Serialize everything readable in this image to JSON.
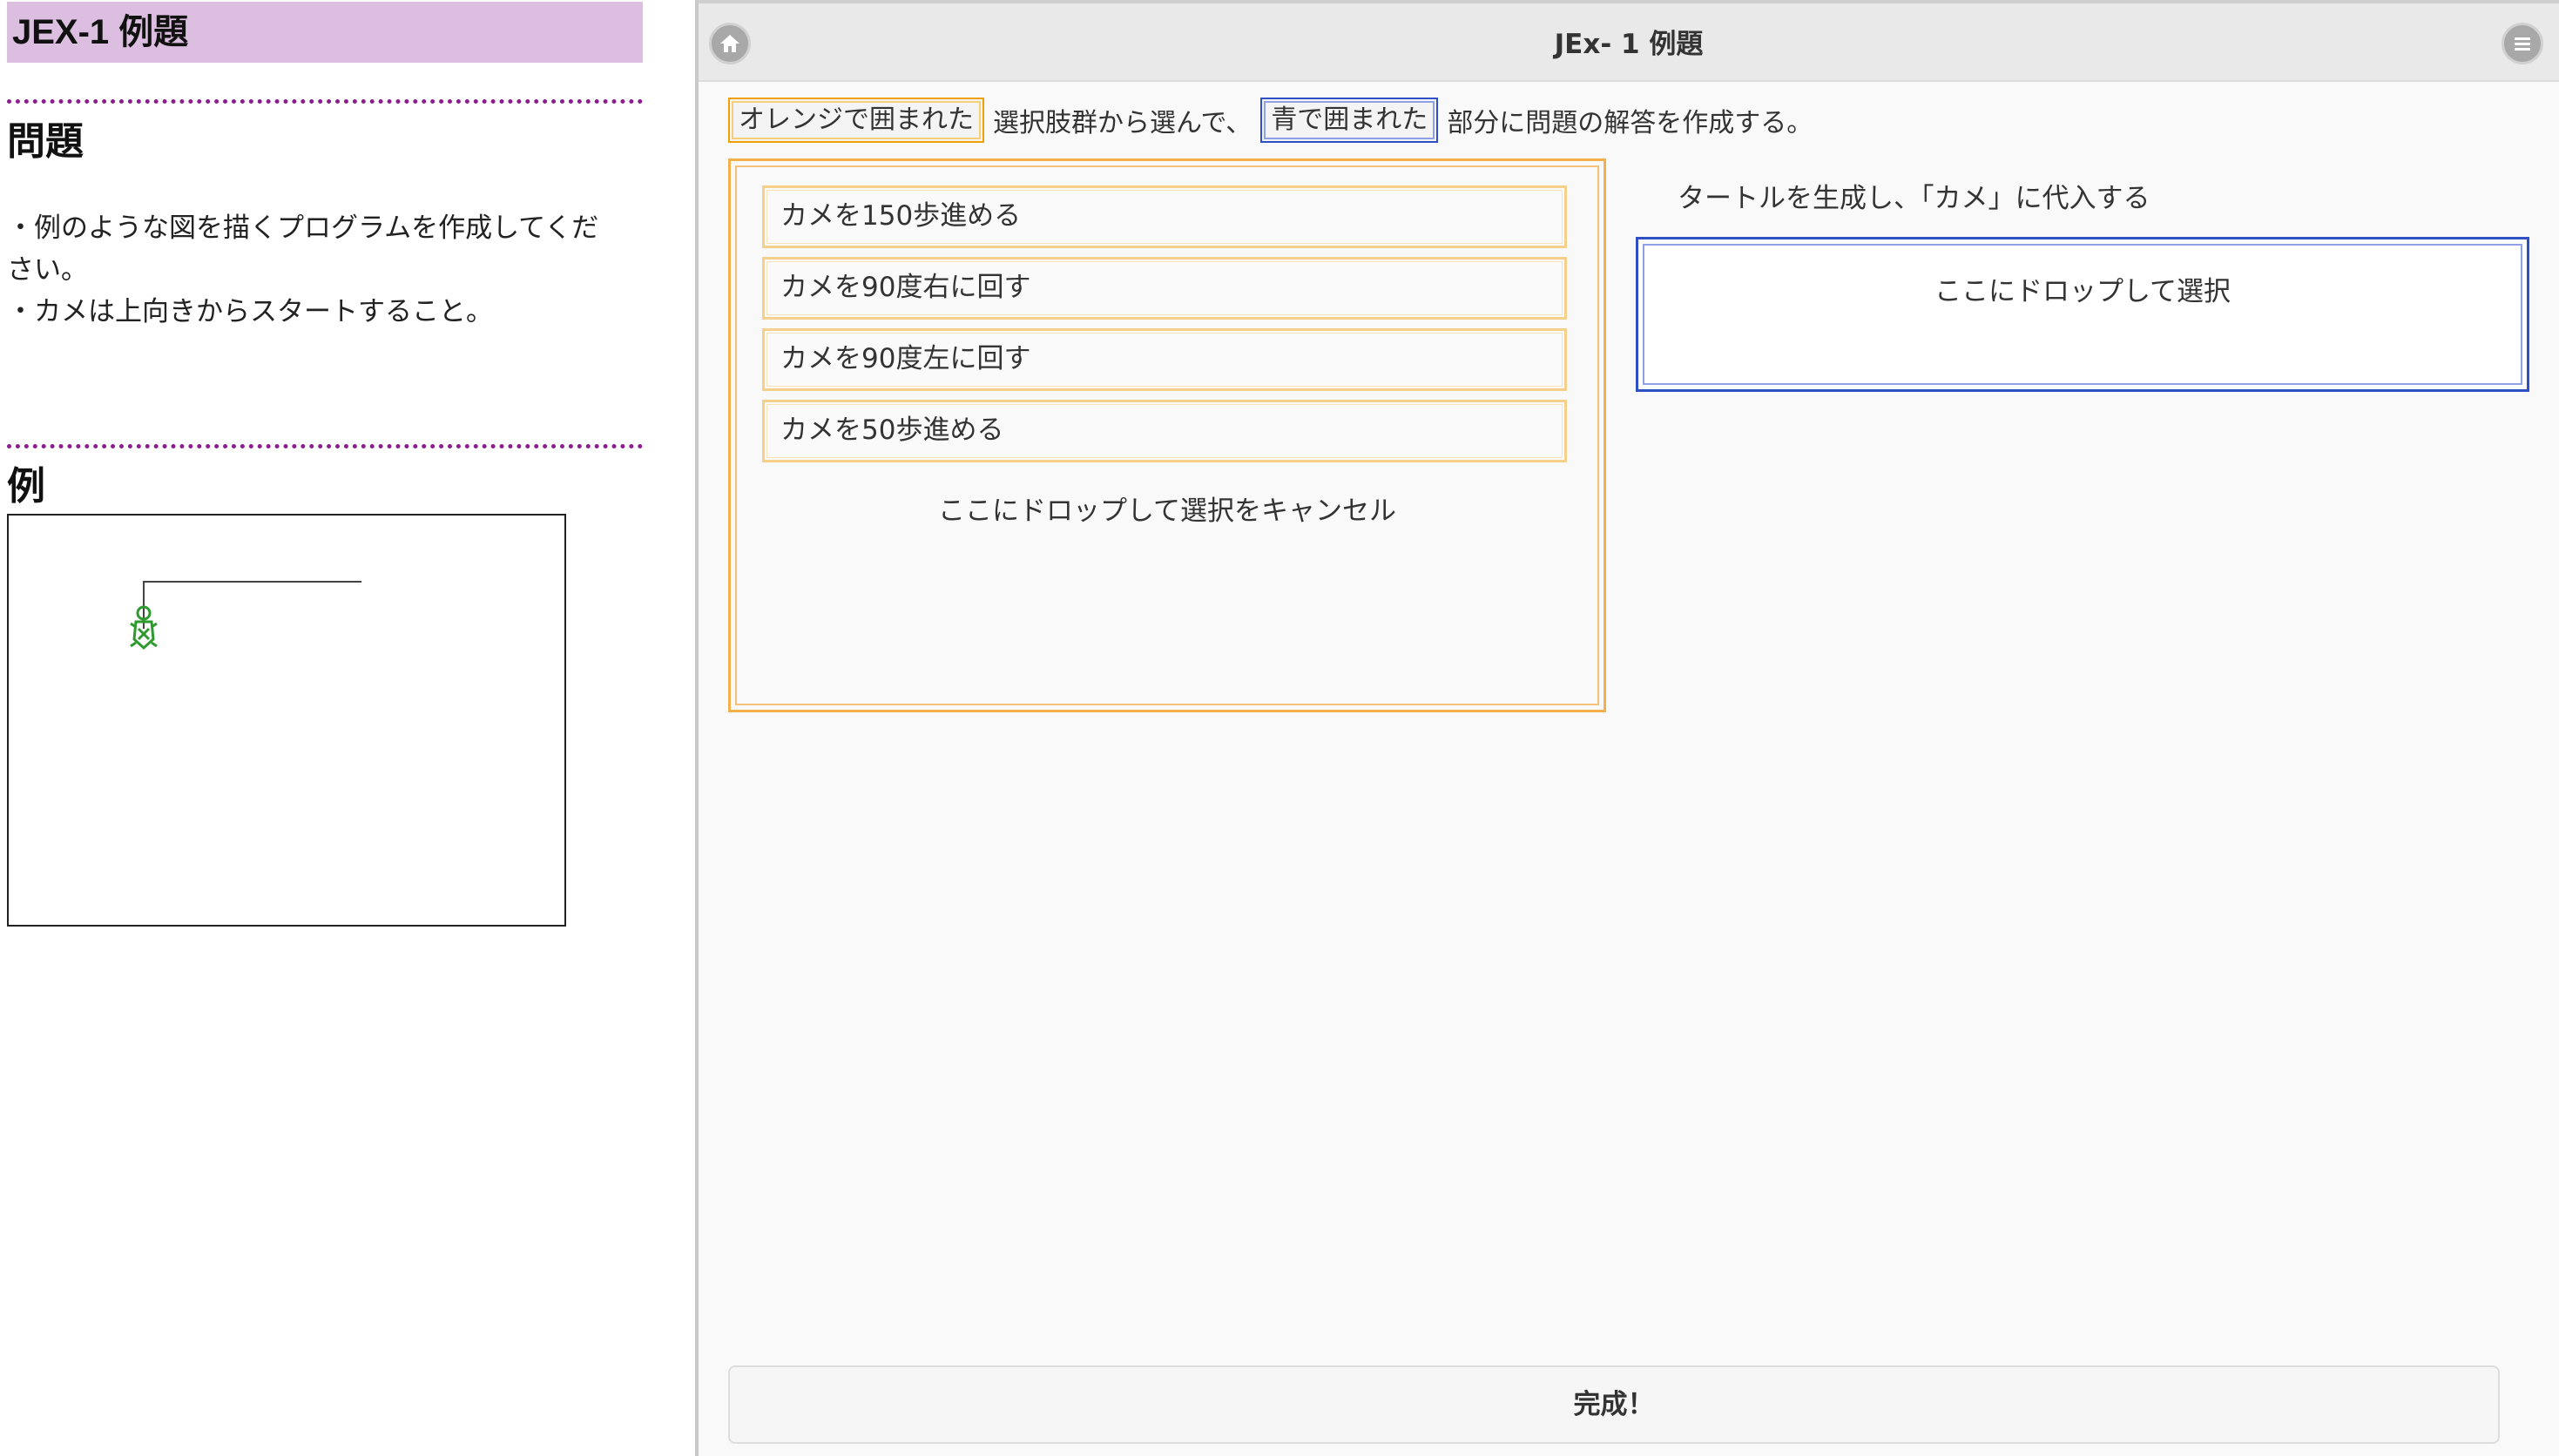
{
  "left_panel": {
    "exercise_title": "JEX-1 例題",
    "problem_heading": "問題",
    "problem_lines": [
      "・例のような図を描くプログラムを作成してくだ",
      "さい。",
      "・カメは上向きからスタートすること。"
    ],
    "example_heading": "例",
    "example_figure": {
      "turtle_color": "#2e9a2e",
      "line_color": "#444444"
    }
  },
  "header": {
    "title": "JEx- 1 例題",
    "home_icon": "home-icon",
    "menu_icon": "menu-icon"
  },
  "instruction": {
    "orange_tag": "オレンジで囲まれた",
    "text_middle": "選択肢群から選んで、",
    "blue_tag": "青で囲まれた",
    "text_end": "部分に問題の解答を作成する。"
  },
  "choices": {
    "items": [
      "カメを150歩進める",
      "カメを90度右に回す",
      "カメを90度左に回す",
      "カメを50歩進める"
    ],
    "cancel_drop_text": "ここにドロップして選択をキャンセル"
  },
  "answer": {
    "step_label": "タートルを生成し、「カメ」に代入する",
    "drop_slot_text": "ここにドロップして選択"
  },
  "footer": {
    "complete_label": "完成！"
  },
  "colors": {
    "title_bg": "#dcbfe0",
    "separator": "#8b1d8f",
    "orange": "#f0a000",
    "blue": "#2f4fc4"
  }
}
